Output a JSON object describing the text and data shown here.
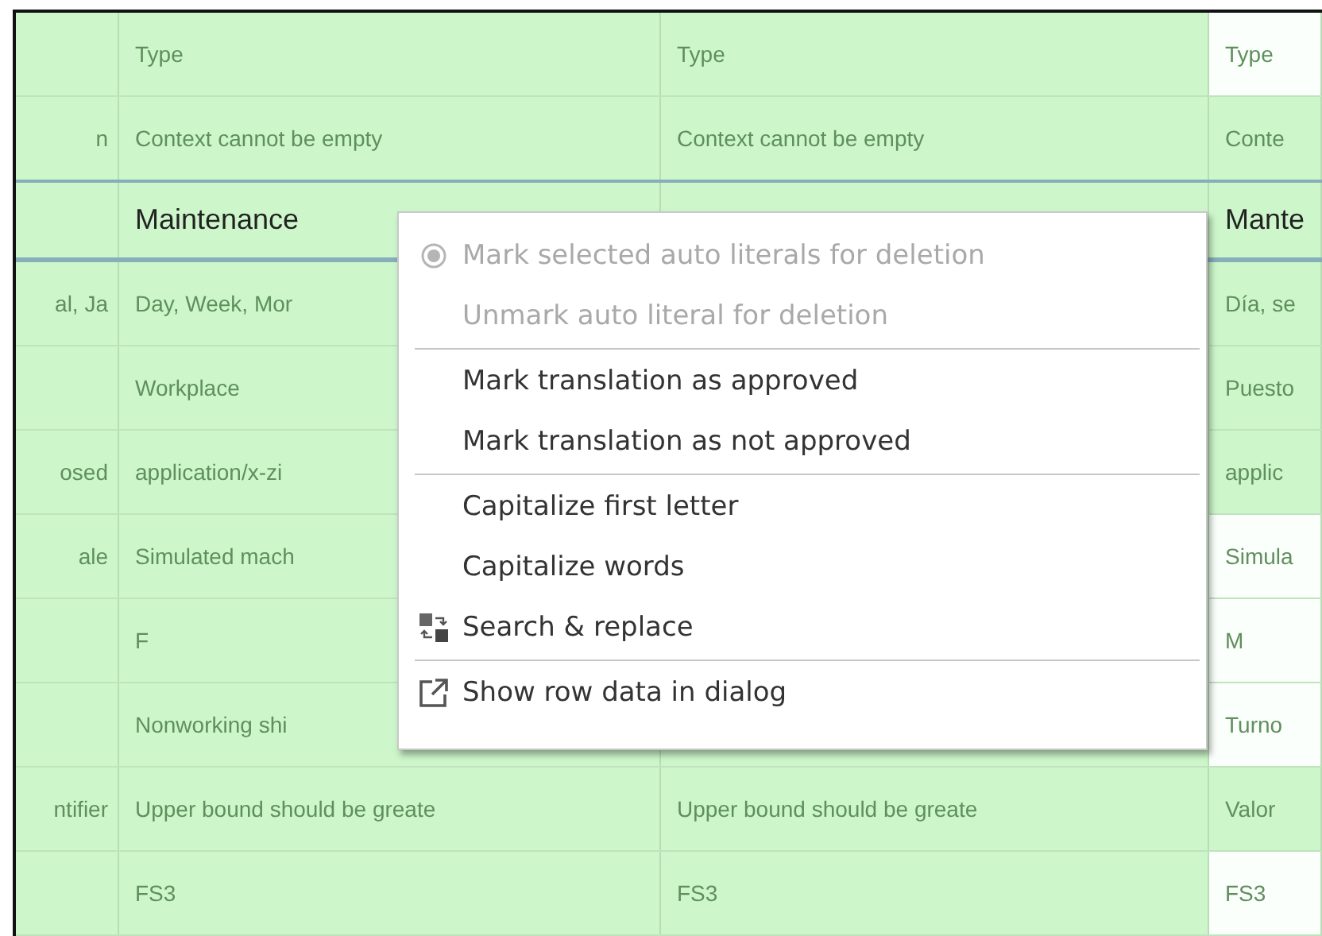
{
  "table": {
    "rows": [
      {
        "selected": false,
        "cells": [
          {},
          {
            "text": "Type"
          },
          {
            "text": "Type"
          },
          {
            "text": "Type",
            "highlighted": false
          }
        ]
      },
      {
        "selected": false,
        "cells": [
          {
            "text": "n"
          },
          {
            "text": "Context cannot be empty"
          },
          {
            "text": "Context cannot be empty"
          },
          {
            "text": "Conte",
            "highlighted": true
          }
        ]
      },
      {
        "selected": true,
        "cells": [
          {},
          {
            "text": "Maintenance"
          },
          {},
          {
            "text": "Mante",
            "highlighted": true
          }
        ]
      },
      {
        "selected": false,
        "cells": [
          {
            "text": "al, Ja"
          },
          {
            "text": "Day, Week, Mor"
          },
          {},
          {
            "text": "Día, se",
            "highlighted": true
          }
        ]
      },
      {
        "selected": false,
        "cells": [
          {},
          {
            "text": "Workplace"
          },
          {},
          {
            "text": "Puesto",
            "highlighted": true
          }
        ]
      },
      {
        "selected": false,
        "cells": [
          {
            "text": "osed"
          },
          {
            "text": "application/x-zi"
          },
          {},
          {
            "text": "applic",
            "highlighted": true
          }
        ]
      },
      {
        "selected": false,
        "cells": [
          {
            "text": "ale"
          },
          {
            "text": "Simulated mach"
          },
          {},
          {
            "text": "Simula",
            "highlighted": false
          }
        ]
      },
      {
        "selected": false,
        "cells": [
          {},
          {
            "text": "F"
          },
          {},
          {
            "text": "M",
            "highlighted": false
          }
        ]
      },
      {
        "selected": false,
        "cells": [
          {},
          {
            "text": "Nonworking shi"
          },
          {},
          {
            "text": "Turno",
            "highlighted": false
          }
        ]
      },
      {
        "selected": false,
        "cells": [
          {
            "text": "ntifier"
          },
          {
            "text": "Upper bound should be greate"
          },
          {
            "text": "Upper bound should be greate"
          },
          {
            "text": "Valor",
            "highlighted": true
          }
        ]
      },
      {
        "selected": false,
        "cells": [
          {},
          {
            "text": "FS3"
          },
          {
            "text": "FS3"
          },
          {
            "text": "FS3",
            "highlighted": false
          }
        ]
      }
    ]
  },
  "context_menu": {
    "groups": [
      [
        {
          "label": "Mark selected auto literals for deletion",
          "kind": "delete",
          "disabled": true
        },
        {
          "label": "Unmark auto literal for deletion",
          "kind": "plain",
          "disabled": true
        }
      ],
      [
        {
          "label": "Mark translation as approved",
          "kind": "plain",
          "disabled": false
        },
        {
          "label": "Mark translation as not approved",
          "kind": "plain",
          "disabled": false
        }
      ],
      [
        {
          "label": "Capitalize first letter",
          "kind": "plain",
          "disabled": false
        },
        {
          "label": "Capitalize words",
          "kind": "plain",
          "disabled": false
        },
        {
          "label": "Search & replace",
          "kind": "replace",
          "disabled": false
        }
      ],
      [
        {
          "label": "Show row data in dialog",
          "kind": "external",
          "disabled": false
        }
      ]
    ]
  }
}
